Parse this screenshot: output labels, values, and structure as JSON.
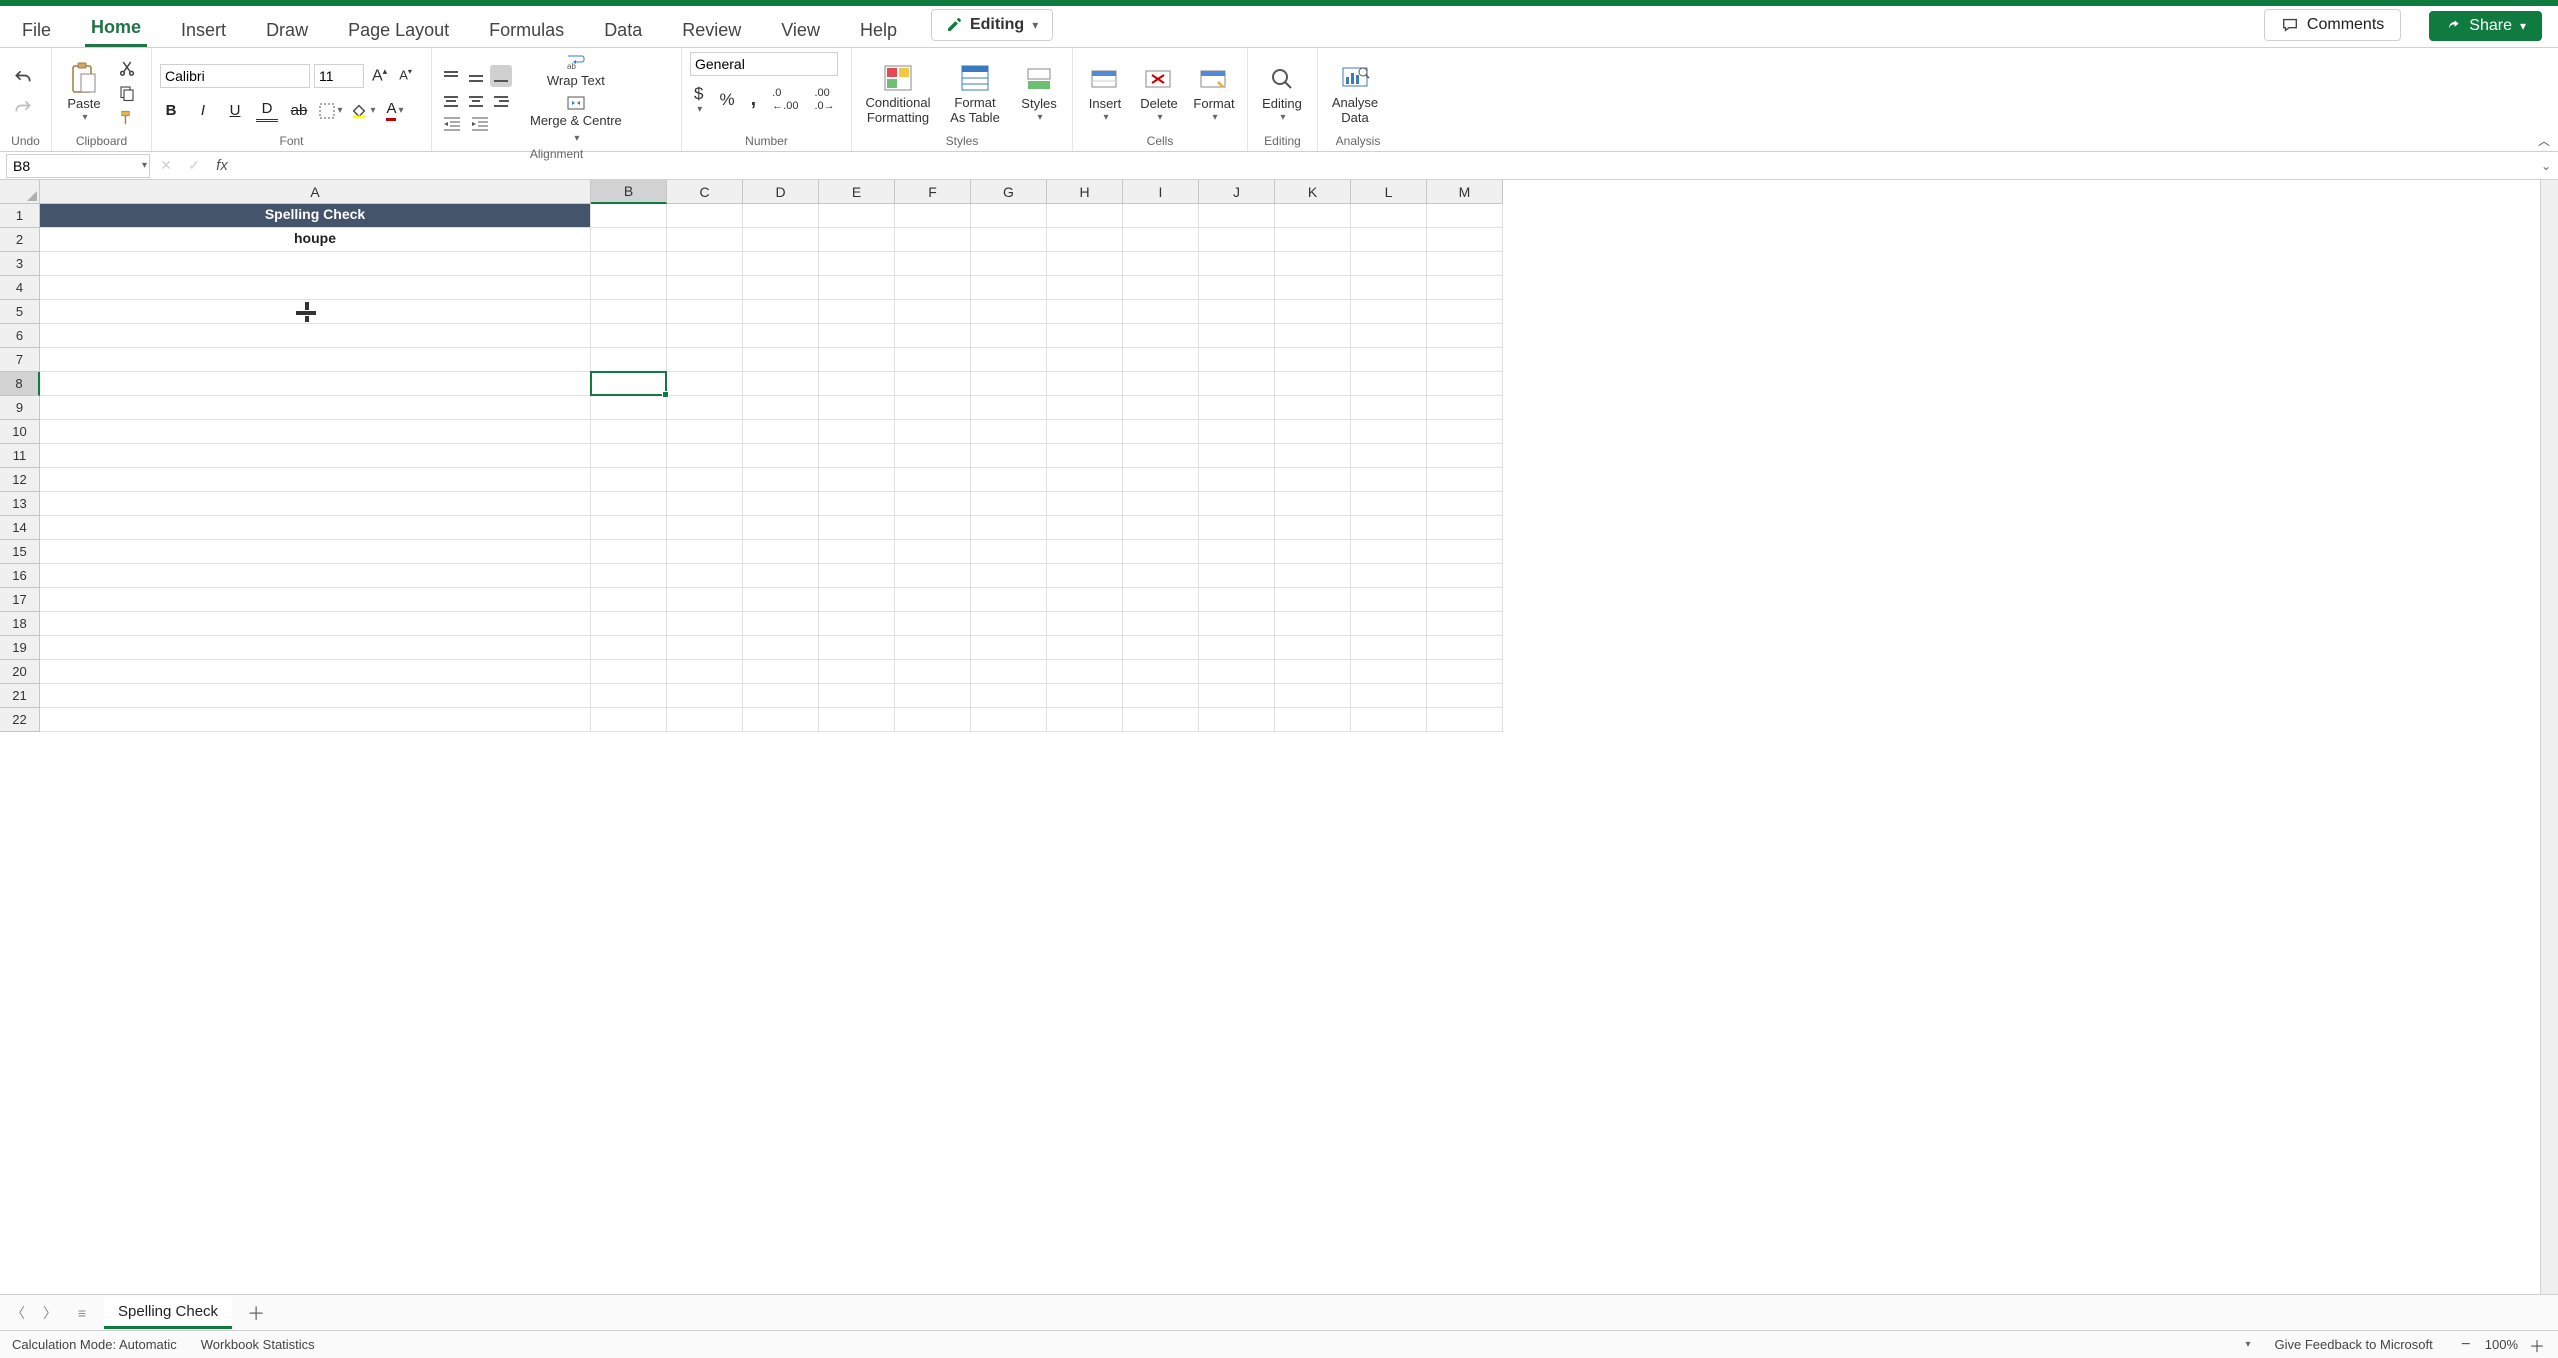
{
  "tabs": {
    "file": "File",
    "home": "Home",
    "insert": "Insert",
    "draw": "Draw",
    "page_layout": "Page Layout",
    "formulas": "Formulas",
    "data": "Data",
    "review": "Review",
    "view": "View",
    "help": "Help"
  },
  "top_buttons": {
    "editing": "Editing",
    "comments": "Comments",
    "share": "Share"
  },
  "ribbon": {
    "undo_group": "Undo",
    "clipboard_group": "Clipboard",
    "paste": "Paste",
    "font_group": "Font",
    "font_name": "Calibri",
    "font_size": "11",
    "alignment_group": "Alignment",
    "wrap_text": "Wrap Text",
    "merge_centre": "Merge & Centre",
    "number_group": "Number",
    "number_format": "General",
    "styles_group": "Styles",
    "conditional_formatting": "Conditional Formatting",
    "format_as_table": "Format As Table",
    "styles": "Styles",
    "cells_group": "Cells",
    "insert": "Insert",
    "delete": "Delete",
    "format": "Format",
    "editing_group": "Editing",
    "editing_btn": "Editing",
    "analysis_group": "Analysis",
    "analyse_data": "Analyse Data"
  },
  "name_box": "B8",
  "formula_value": "",
  "columns": [
    "A",
    "B",
    "C",
    "D",
    "E",
    "F",
    "G",
    "H",
    "I",
    "J",
    "K",
    "L",
    "M"
  ],
  "col_A_width": 551,
  "col_default_width": 76,
  "row_count": 22,
  "selected_cell": "B8",
  "selected_col_index": 1,
  "selected_row_index": 7,
  "cells": {
    "A1": "Spelling Check",
    "A2": "houpe"
  },
  "colors": {
    "a1_bg": "#44546a",
    "a1_fg": "#ffffff"
  },
  "sheet_tab": "Spelling Check",
  "status": {
    "calc_mode": "Calculation Mode: Automatic",
    "workbook_stats": "Workbook Statistics",
    "feedback": "Give Feedback to Microsoft",
    "zoom": "100%"
  },
  "cursor_pos": {
    "col": "A",
    "row": 5
  }
}
